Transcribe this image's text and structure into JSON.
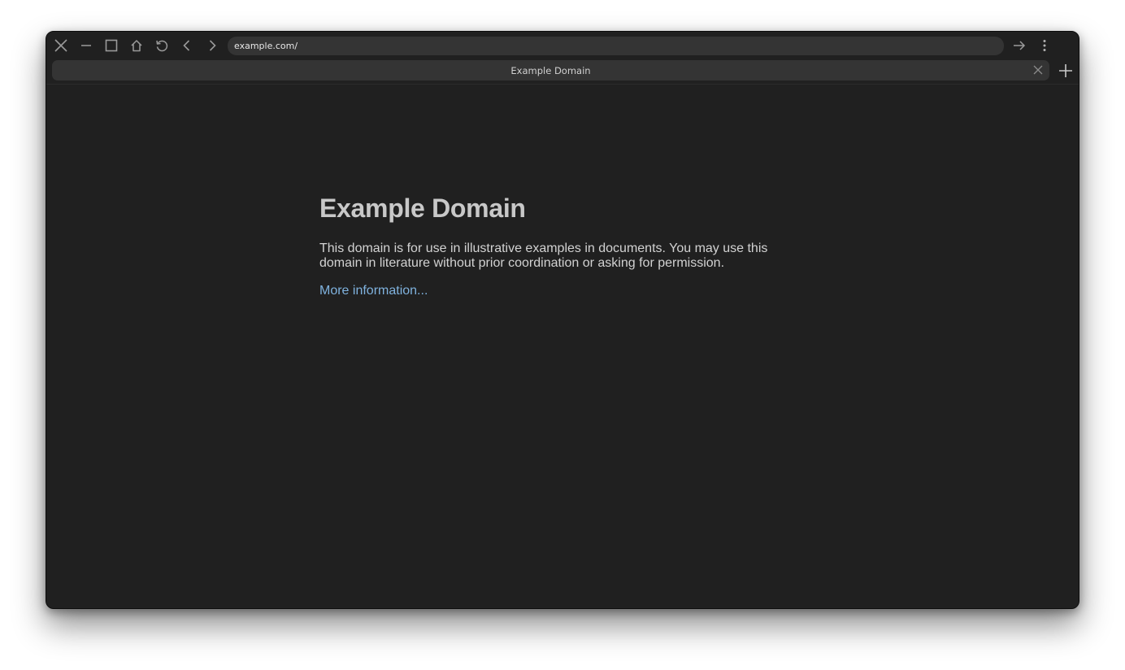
{
  "browser": {
    "address_value": "example.com/",
    "tab_title": "Example Domain",
    "icons": {
      "close": "close-icon",
      "minimize": "minimize-icon",
      "maximize": "maximize-icon",
      "home": "home-icon",
      "reload": "reload-icon",
      "back": "back-arrow-icon",
      "forward": "forward-arrow-icon",
      "go": "go-arrow-icon",
      "menu": "vertical-dots-icon",
      "tab_close": "tab-close-icon",
      "new_tab": "plus-icon"
    }
  },
  "page": {
    "heading": "Example Domain",
    "description": "This domain is for use in illustrative examples in documents. You may use this domain in literature without prior coordination or asking for permission.",
    "link_text": "More information..."
  },
  "colors": {
    "background": "#202020",
    "chrome": "#343434",
    "heading": "#c8c8c8",
    "link": "#7fb2de"
  }
}
